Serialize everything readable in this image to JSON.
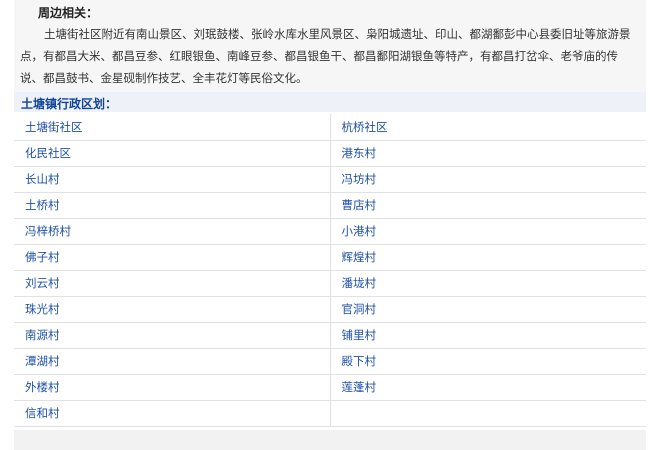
{
  "nearby": {
    "heading": "周边相关：",
    "text": "土塘街社区附近有南山景区、刘珉鼓楼、张岭水库水里风景区、枭阳城遗址、印山、都湖鄱彭中心县委旧址等旅游景点，有都昌大米、都昌豆参、红眼银鱼、南峰豆参、都昌银鱼干、都昌鄱阳湖银鱼等特产，有都昌打岔伞、老爷庙的传说、都昌鼓书、金星砚制作技艺、全丰花灯等民俗文化。"
  },
  "district": {
    "title": "土塘镇行政区划：",
    "rows": [
      {
        "left": "土塘街社区",
        "right": "杭桥社区"
      },
      {
        "left": "化民社区",
        "right": "港东村"
      },
      {
        "left": "长山村",
        "right": "冯坊村"
      },
      {
        "left": "土桥村",
        "right": "曹店村"
      },
      {
        "left": "冯梓桥村",
        "right": "小港村"
      },
      {
        "left": "佛子村",
        "right": "辉煌村"
      },
      {
        "left": "刘云村",
        "right": "潘垅村"
      },
      {
        "left": "珠光村",
        "right": "官洞村"
      },
      {
        "left": "南源村",
        "right": "铺里村"
      },
      {
        "left": "潭湖村",
        "right": "殿下村"
      },
      {
        "left": "外楼村",
        "right": "莲蓬村"
      },
      {
        "left": "信和村",
        "right": ""
      }
    ]
  }
}
